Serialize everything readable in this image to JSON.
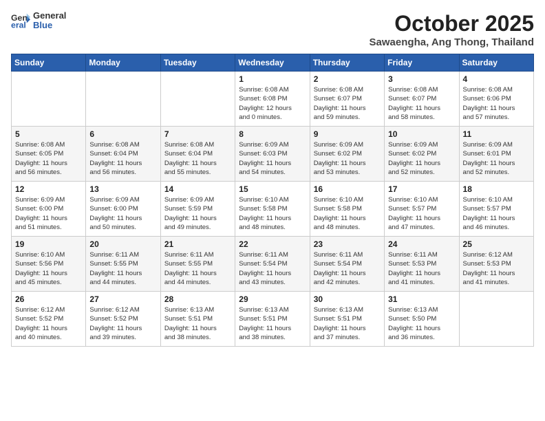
{
  "header": {
    "logo_general": "General",
    "logo_blue": "Blue",
    "title": "October 2025",
    "location": "Sawaengha, Ang Thong, Thailand"
  },
  "weekdays": [
    "Sunday",
    "Monday",
    "Tuesday",
    "Wednesday",
    "Thursday",
    "Friday",
    "Saturday"
  ],
  "weeks": [
    [
      {
        "day": "",
        "info": ""
      },
      {
        "day": "",
        "info": ""
      },
      {
        "day": "",
        "info": ""
      },
      {
        "day": "1",
        "info": "Sunrise: 6:08 AM\nSunset: 6:08 PM\nDaylight: 12 hours\nand 0 minutes."
      },
      {
        "day": "2",
        "info": "Sunrise: 6:08 AM\nSunset: 6:07 PM\nDaylight: 11 hours\nand 59 minutes."
      },
      {
        "day": "3",
        "info": "Sunrise: 6:08 AM\nSunset: 6:07 PM\nDaylight: 11 hours\nand 58 minutes."
      },
      {
        "day": "4",
        "info": "Sunrise: 6:08 AM\nSunset: 6:06 PM\nDaylight: 11 hours\nand 57 minutes."
      }
    ],
    [
      {
        "day": "5",
        "info": "Sunrise: 6:08 AM\nSunset: 6:05 PM\nDaylight: 11 hours\nand 56 minutes."
      },
      {
        "day": "6",
        "info": "Sunrise: 6:08 AM\nSunset: 6:04 PM\nDaylight: 11 hours\nand 56 minutes."
      },
      {
        "day": "7",
        "info": "Sunrise: 6:08 AM\nSunset: 6:04 PM\nDaylight: 11 hours\nand 55 minutes."
      },
      {
        "day": "8",
        "info": "Sunrise: 6:09 AM\nSunset: 6:03 PM\nDaylight: 11 hours\nand 54 minutes."
      },
      {
        "day": "9",
        "info": "Sunrise: 6:09 AM\nSunset: 6:02 PM\nDaylight: 11 hours\nand 53 minutes."
      },
      {
        "day": "10",
        "info": "Sunrise: 6:09 AM\nSunset: 6:02 PM\nDaylight: 11 hours\nand 52 minutes."
      },
      {
        "day": "11",
        "info": "Sunrise: 6:09 AM\nSunset: 6:01 PM\nDaylight: 11 hours\nand 52 minutes."
      }
    ],
    [
      {
        "day": "12",
        "info": "Sunrise: 6:09 AM\nSunset: 6:00 PM\nDaylight: 11 hours\nand 51 minutes."
      },
      {
        "day": "13",
        "info": "Sunrise: 6:09 AM\nSunset: 6:00 PM\nDaylight: 11 hours\nand 50 minutes."
      },
      {
        "day": "14",
        "info": "Sunrise: 6:09 AM\nSunset: 5:59 PM\nDaylight: 11 hours\nand 49 minutes."
      },
      {
        "day": "15",
        "info": "Sunrise: 6:10 AM\nSunset: 5:58 PM\nDaylight: 11 hours\nand 48 minutes."
      },
      {
        "day": "16",
        "info": "Sunrise: 6:10 AM\nSunset: 5:58 PM\nDaylight: 11 hours\nand 48 minutes."
      },
      {
        "day": "17",
        "info": "Sunrise: 6:10 AM\nSunset: 5:57 PM\nDaylight: 11 hours\nand 47 minutes."
      },
      {
        "day": "18",
        "info": "Sunrise: 6:10 AM\nSunset: 5:57 PM\nDaylight: 11 hours\nand 46 minutes."
      }
    ],
    [
      {
        "day": "19",
        "info": "Sunrise: 6:10 AM\nSunset: 5:56 PM\nDaylight: 11 hours\nand 45 minutes."
      },
      {
        "day": "20",
        "info": "Sunrise: 6:11 AM\nSunset: 5:55 PM\nDaylight: 11 hours\nand 44 minutes."
      },
      {
        "day": "21",
        "info": "Sunrise: 6:11 AM\nSunset: 5:55 PM\nDaylight: 11 hours\nand 44 minutes."
      },
      {
        "day": "22",
        "info": "Sunrise: 6:11 AM\nSunset: 5:54 PM\nDaylight: 11 hours\nand 43 minutes."
      },
      {
        "day": "23",
        "info": "Sunrise: 6:11 AM\nSunset: 5:54 PM\nDaylight: 11 hours\nand 42 minutes."
      },
      {
        "day": "24",
        "info": "Sunrise: 6:11 AM\nSunset: 5:53 PM\nDaylight: 11 hours\nand 41 minutes."
      },
      {
        "day": "25",
        "info": "Sunrise: 6:12 AM\nSunset: 5:53 PM\nDaylight: 11 hours\nand 41 minutes."
      }
    ],
    [
      {
        "day": "26",
        "info": "Sunrise: 6:12 AM\nSunset: 5:52 PM\nDaylight: 11 hours\nand 40 minutes."
      },
      {
        "day": "27",
        "info": "Sunrise: 6:12 AM\nSunset: 5:52 PM\nDaylight: 11 hours\nand 39 minutes."
      },
      {
        "day": "28",
        "info": "Sunrise: 6:13 AM\nSunset: 5:51 PM\nDaylight: 11 hours\nand 38 minutes."
      },
      {
        "day": "29",
        "info": "Sunrise: 6:13 AM\nSunset: 5:51 PM\nDaylight: 11 hours\nand 38 minutes."
      },
      {
        "day": "30",
        "info": "Sunrise: 6:13 AM\nSunset: 5:51 PM\nDaylight: 11 hours\nand 37 minutes."
      },
      {
        "day": "31",
        "info": "Sunrise: 6:13 AM\nSunset: 5:50 PM\nDaylight: 11 hours\nand 36 minutes."
      },
      {
        "day": "",
        "info": ""
      }
    ]
  ]
}
